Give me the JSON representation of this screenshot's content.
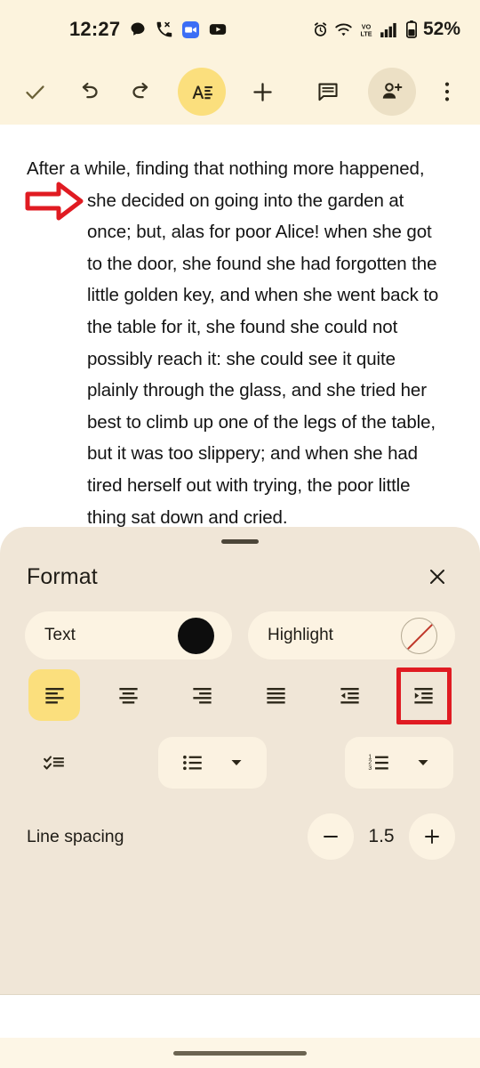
{
  "statusbar": {
    "time": "12:27",
    "battery_text": "52%",
    "left_icons": [
      "message-bubble-icon",
      "missed-call-icon",
      "meet-icon",
      "youtube-icon"
    ],
    "right_icons": [
      "alarm-icon",
      "wifi-icon",
      "vpn-lte-icon",
      "signal-bars-icon",
      "battery-icon"
    ]
  },
  "toolbar": {
    "done_label": "done-check-icon",
    "items": [
      {
        "name": "done-check-button",
        "icon": "check-icon"
      },
      {
        "name": "undo-button",
        "icon": "undo-icon"
      },
      {
        "name": "redo-button",
        "icon": "redo-icon"
      },
      {
        "name": "format-text-button",
        "icon": "format-text-icon"
      },
      {
        "name": "insert-button",
        "icon": "plus-icon"
      },
      {
        "name": "comment-button",
        "icon": "comment-icon"
      },
      {
        "name": "share-button",
        "icon": "person-add-icon"
      },
      {
        "name": "more-options-button",
        "icon": "more-vert-icon"
      }
    ]
  },
  "document": {
    "lines": [
      {
        "text": "After a while, finding that nothing more happened,",
        "indented": false
      },
      {
        "text": "she decided on going into the garden at",
        "indented": true
      },
      {
        "text": "once; but, alas for poor Alice! when she got",
        "indented": true
      },
      {
        "text": "to the door, she found she had forgotten the",
        "indented": true
      },
      {
        "text": "little golden key, and when she went back to",
        "indented": true
      },
      {
        "text": "the table for it, she found she could not",
        "indented": true
      },
      {
        "text": "possibly reach it: she could see it quite",
        "indented": true
      },
      {
        "text": "plainly through the glass, and she tried her",
        "indented": true
      },
      {
        "text": "best to climb up one of the legs of the table,",
        "indented": true
      },
      {
        "text": "but it was too slippery; and when she had",
        "indented": true
      },
      {
        "text": "tired herself out with trying, the poor little",
        "indented": true
      },
      {
        "text": "thing sat down and cried.",
        "indented": true
      }
    ]
  },
  "annotations": {
    "arrow_color": "#e01b22",
    "box_color": "#e01b22",
    "arrow_target": "indented-paragraph",
    "box_target": "increase-indent-button"
  },
  "format_sheet": {
    "title": "Format",
    "close_icon": "close-icon",
    "color_chips": [
      {
        "label": "Text",
        "swatch": "black-circle",
        "color": "#0d0d0d"
      },
      {
        "label": "Highlight",
        "swatch": "none-circle",
        "color": "none"
      }
    ],
    "alignment": [
      {
        "name": "align-left-button",
        "icon": "align-left-icon",
        "active": true,
        "annotated": false
      },
      {
        "name": "align-center-button",
        "icon": "align-center-icon",
        "active": false,
        "annotated": false
      },
      {
        "name": "align-right-button",
        "icon": "align-right-icon",
        "active": false,
        "annotated": false
      },
      {
        "name": "align-justify-button",
        "icon": "align-justify-icon",
        "active": false,
        "annotated": false
      },
      {
        "name": "decrease-indent-button",
        "icon": "indent-decrease-icon",
        "active": false,
        "annotated": false
      },
      {
        "name": "increase-indent-button",
        "icon": "indent-increase-icon",
        "active": false,
        "annotated": true
      }
    ],
    "lists": [
      {
        "name": "checklist-button",
        "icon": "checklist-icon",
        "has_dropdown": false,
        "pill": false
      },
      {
        "name": "bulleted-list-button",
        "icon": "bulleted-list-icon",
        "has_dropdown": true,
        "pill": true
      },
      {
        "name": "numbered-list-button",
        "icon": "numbered-list-icon",
        "has_dropdown": true,
        "pill": true
      }
    ],
    "line_spacing": {
      "label": "Line spacing",
      "value": "1.5",
      "decrease_icon": "minus-icon",
      "increase_icon": "plus-icon"
    }
  },
  "navbar": {
    "gesture_pill": "home-gesture-pill"
  },
  "colors": {
    "status_bg": "#fcf3dd",
    "toolbar_bg": "#fcf3dd",
    "sheet_bg": "#f0e6d7",
    "chip_bg": "#fcf3e2",
    "accent_yellow": "#fbdf7d",
    "annotation_red": "#e01b22",
    "text_primary": "#1f1c16"
  }
}
